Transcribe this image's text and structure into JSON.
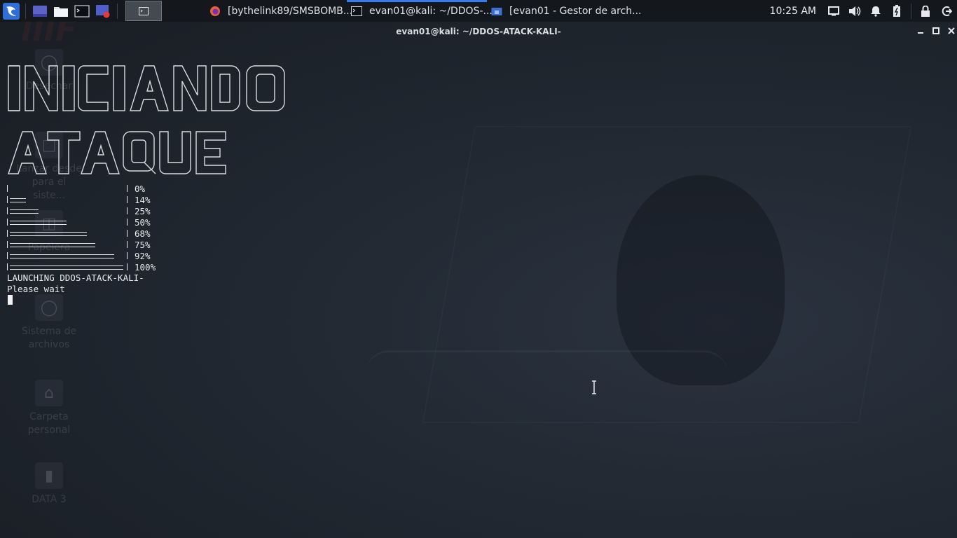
{
  "panel": {
    "tasks": [
      {
        "label": "[bythelink89/SMSBOMB...",
        "icon": "firefox-icon"
      },
      {
        "label": "evan01@kali: ~/DDOS-...",
        "icon": "terminal-icon"
      },
      {
        "label": "[evan01 - Gestor de arch...",
        "icon": "file-manager-icon"
      }
    ],
    "clock": "10:25 AM"
  },
  "desktop_icons": [
    {
      "label": "Desechar",
      "icon": "trash-icon"
    },
    {
      "label": "Lanzar desde para el siste...",
      "icon": "launcher-icon"
    },
    {
      "label": "Papelera",
      "icon": "trash-icon"
    },
    {
      "label": "Sistema de archivos",
      "icon": "drive-icon"
    },
    {
      "label": "Carpeta personal",
      "icon": "home-folder-icon"
    },
    {
      "label": "DATA 3",
      "icon": "usb-drive-icon"
    }
  ],
  "terminal": {
    "title": "evan01@kali: ~/DDOS-ATACK-KALI-",
    "progress": [
      {
        "label": "0%",
        "fraction": 0.0
      },
      {
        "label": "14%",
        "fraction": 0.14
      },
      {
        "label": "25%",
        "fraction": 0.25
      },
      {
        "label": "50%",
        "fraction": 0.5
      },
      {
        "label": "68%",
        "fraction": 0.68
      },
      {
        "label": "75%",
        "fraction": 0.75
      },
      {
        "label": "92%",
        "fraction": 0.92
      },
      {
        "label": "100%",
        "fraction": 1.0
      }
    ],
    "launch_message": "LAUNCHING DDOS-ATACK-KALI-",
    "wait_message": "Please wait"
  },
  "colors": {
    "panel_bg": "#14171c",
    "active_task_accent": "#367bf0",
    "terminal_text": "#e8eaee"
  }
}
